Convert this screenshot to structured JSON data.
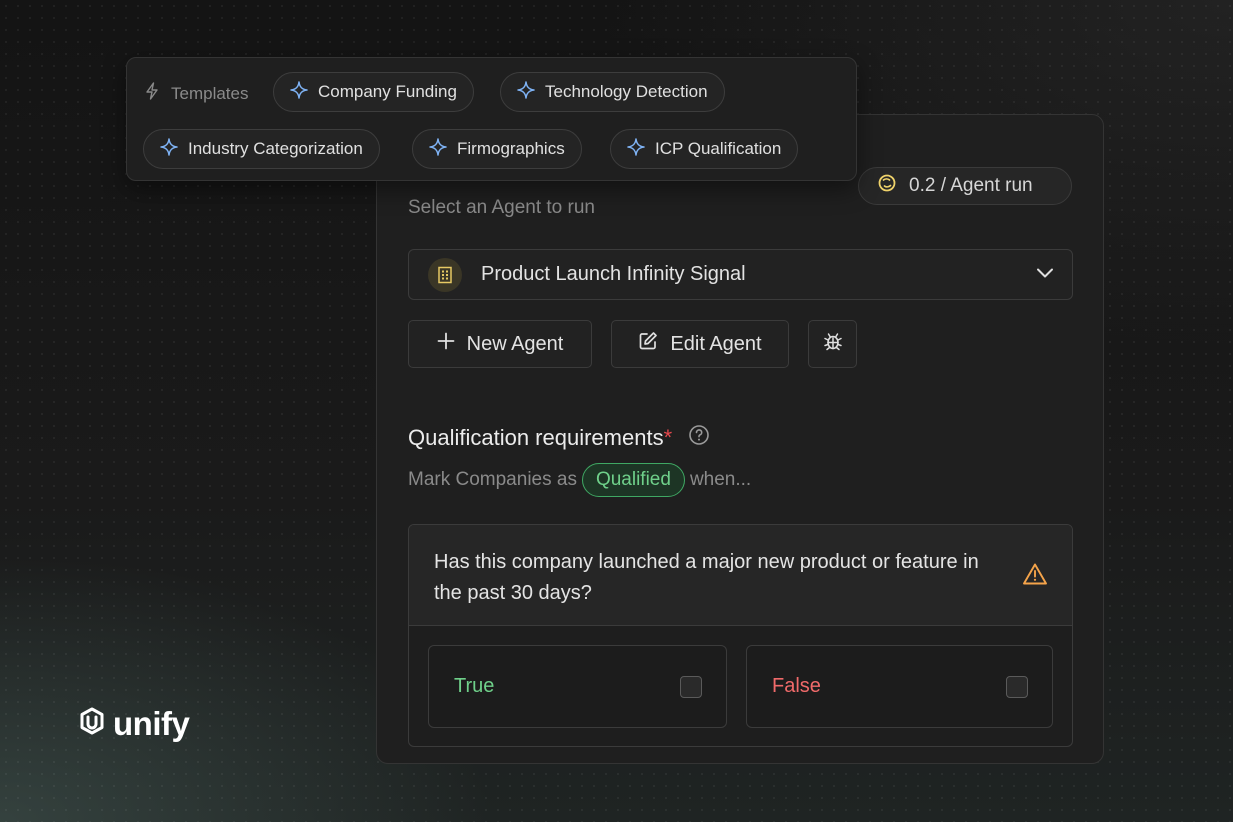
{
  "templates": {
    "label": "Templates",
    "chips": [
      {
        "label": "Company Funding"
      },
      {
        "label": "Technology Detection"
      },
      {
        "label": "Industry Categorization"
      },
      {
        "label": "Firmographics"
      },
      {
        "label": "ICP Qualification"
      }
    ]
  },
  "cost": {
    "label": "0.2 / Agent run",
    "icon": "coin-icon"
  },
  "agent": {
    "select_label": "Select an Agent to run",
    "selected": "Product Launch Infinity Signal",
    "icon": "building-icon"
  },
  "buttons": {
    "new_agent": "New Agent",
    "edit_agent": "Edit Agent",
    "debug_icon": "bug-icon"
  },
  "qualification": {
    "title": "Qualification requirements",
    "required_marker": "*",
    "mark_prefix": "Mark Companies as",
    "badge": "Qualified",
    "mark_suffix": "when..."
  },
  "question": {
    "text": "Has this company launched a major new product or feature in the past 30 days?",
    "warning_icon": "warning-icon",
    "answers": [
      {
        "label": "True",
        "color": "#6fd08a",
        "checked": false
      },
      {
        "label": "False",
        "color": "#f06a6a",
        "checked": false
      }
    ]
  },
  "brand": {
    "name": "unify"
  },
  "colors": {
    "accent_blue": "#7fb3f5",
    "qualified_green": "#3fa863",
    "warning_orange": "#f5a44a",
    "required_red": "#e5484d"
  }
}
